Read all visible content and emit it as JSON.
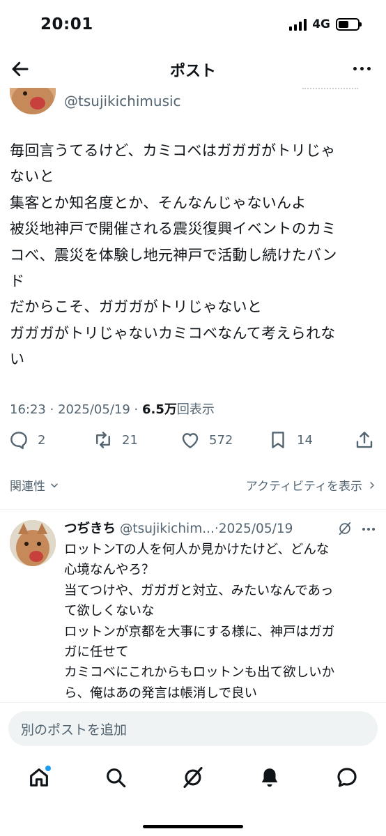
{
  "status_bar": {
    "time": "20:01",
    "network": "4G"
  },
  "nav": {
    "title": "ポスト"
  },
  "post": {
    "handle": "@tsujikichimusic",
    "text_lines": [
      "毎回言うてるけど、カミコベはガガガがトリじゃ",
      "ないと",
      "集客とか知名度とか、そんなんじゃないんよ",
      "被災地神戸で開催される震災復興イベントのカミ",
      "コべ、震災を体験し地元神戸で活動し続けたバン",
      "ド",
      "だからこそ、ガガガがトリじゃないと",
      "ガガガがトリじゃないカミコベなんて考えられな",
      "い"
    ],
    "time": "16:23",
    "date": "2025/05/19",
    "views_count": "6.5万",
    "views_label": "回表示",
    "replies": "2",
    "reposts": "21",
    "likes": "572",
    "bookmarks": "14"
  },
  "links": {
    "relevance": "関連性",
    "activity": "アクティビティを表示"
  },
  "reply": {
    "name": "つぢきち",
    "handle": "@tsujikichim...",
    "date": "·2025/05/19",
    "text_lines": [
      "ロットンTの人を何人か見かけたけど、どんな",
      "心境なんやろ？",
      "当てつけや、ガガガと対立、みたいなんであっ",
      "て欲しくないな",
      "ロットンが京都を大事にする様に、神戸はガガ",
      "ガに任せて",
      "カミコベにこれからもロットンも出て欲しいか",
      "ら、俺はあの発言は帳消しで良い"
    ]
  },
  "compose": {
    "placeholder": "別のポストを追加"
  },
  "tabs": [
    "home-icon",
    "search-icon",
    "grok-icon",
    "notifications-icon",
    "messages-icon"
  ],
  "colors": {
    "text": "#0f1419",
    "secondary": "#536471",
    "accent": "#1d9bf0",
    "compose_bg": "#eff3f4"
  }
}
